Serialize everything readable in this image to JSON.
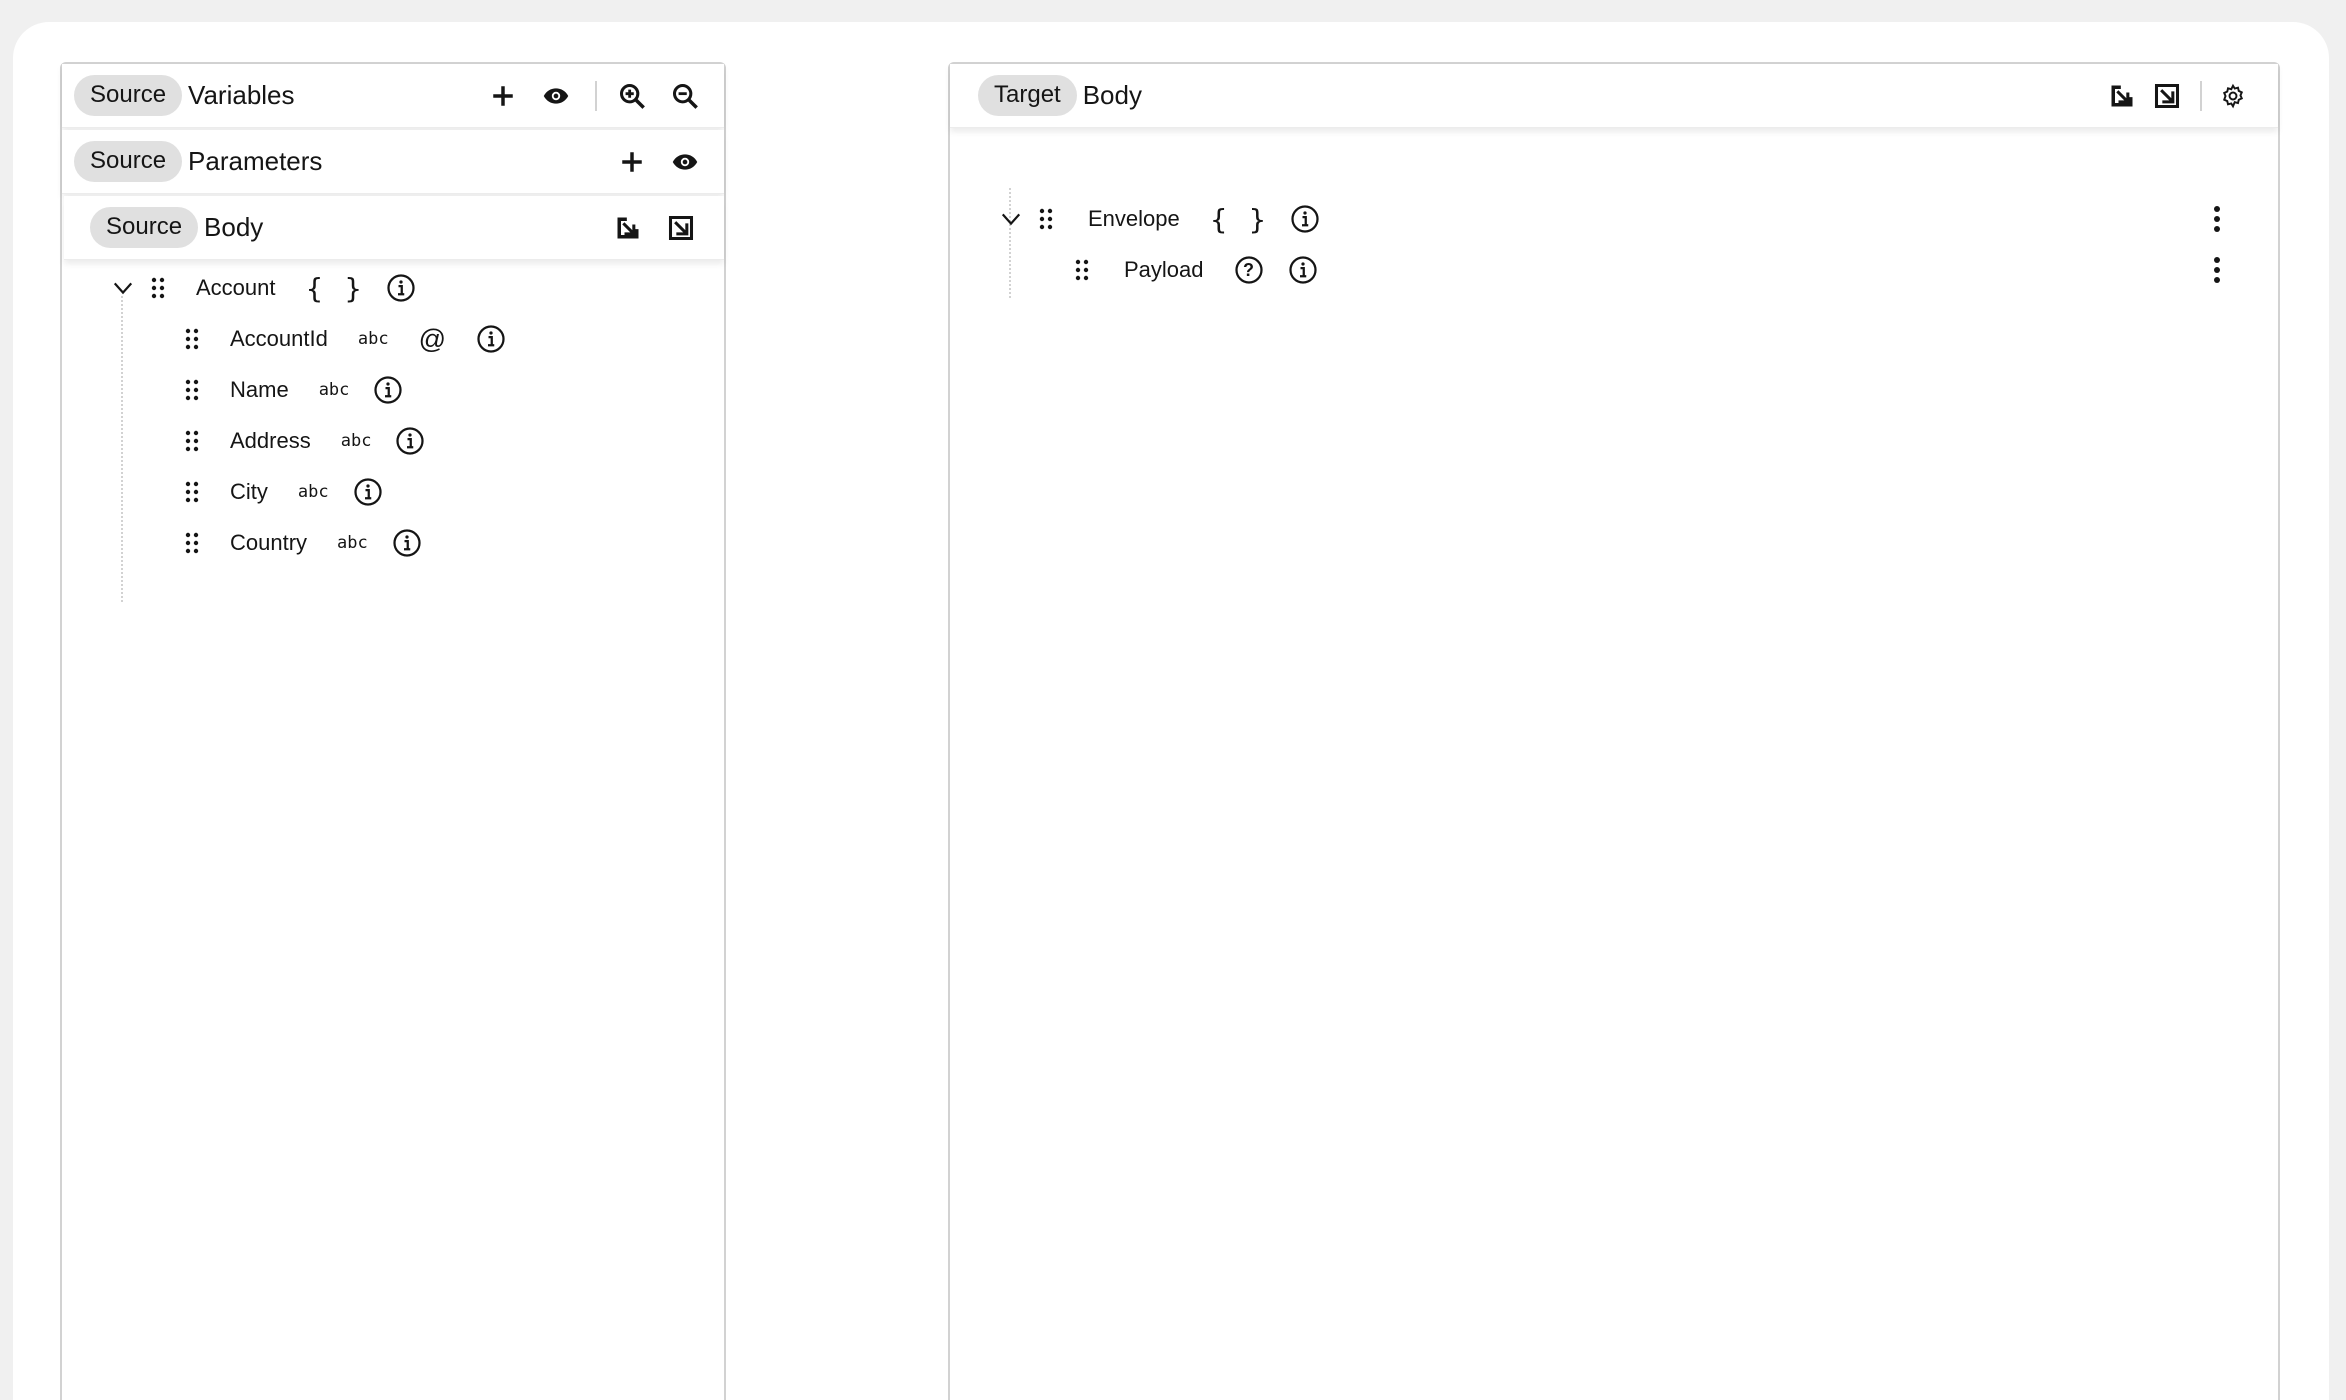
{
  "source_panel": {
    "variables_header": {
      "chip": "Source",
      "title": "Variables"
    },
    "parameters_header": {
      "chip": "Source",
      "title": "Parameters"
    },
    "body_header": {
      "chip": "Source",
      "title": "Body"
    },
    "tree": {
      "root": {
        "label": "Account",
        "type_badge": "{ }"
      },
      "children": [
        {
          "label": "AccountId",
          "type_badge": "abc",
          "extra_badge": "@"
        },
        {
          "label": "Name",
          "type_badge": "abc"
        },
        {
          "label": "Address",
          "type_badge": "abc"
        },
        {
          "label": "City",
          "type_badge": "abc"
        },
        {
          "label": "Country",
          "type_badge": "abc"
        }
      ]
    }
  },
  "target_panel": {
    "body_header": {
      "chip": "Target",
      "title": "Body"
    },
    "tree": {
      "root": {
        "label": "Envelope",
        "type_badge": "{ }"
      },
      "children": [
        {
          "label": "Payload",
          "type_badge": "?"
        }
      ]
    }
  },
  "icons": {
    "add": "plus-icon",
    "show": "eye-icon",
    "zoom_in": "zoom-in-icon",
    "zoom_out": "zoom-out-icon",
    "import": "import-icon",
    "export": "export-icon",
    "settings": "gear-icon",
    "expand": "chevron-down-icon",
    "drag": "drag-handle-icon",
    "info": "info-icon",
    "menu": "kebab-menu-icon"
  },
  "colors": {
    "chip_bg": "#e0e0e0",
    "border": "#d2d2d2",
    "background": "#f0f0f0",
    "text": "#151515"
  }
}
